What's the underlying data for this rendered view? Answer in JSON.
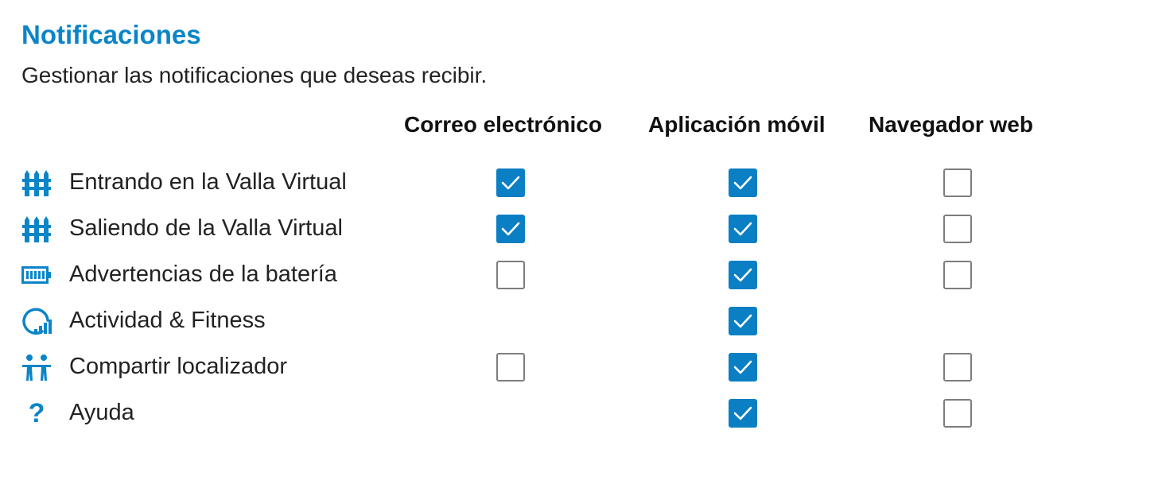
{
  "header": {
    "title": "Notificaciones",
    "subtitle": "Gestionar las notificaciones que deseas recibir."
  },
  "columns": [
    {
      "label": "Correo electrónico"
    },
    {
      "label": "Aplicación móvil"
    },
    {
      "label": "Navegador web"
    }
  ],
  "colors": {
    "accent": "#0a85c8",
    "checkbox_checked": "#0a7fc4",
    "checkbox_border": "#7d7d7d"
  },
  "rows": [
    {
      "label": "Entrando en la Valla Virtual",
      "icon": "fence-icon",
      "email": true,
      "app": true,
      "web": false
    },
    {
      "label": "Saliendo de la Valla Virtual",
      "icon": "fence-icon",
      "email": true,
      "app": true,
      "web": false
    },
    {
      "label": "Advertencias de la batería",
      "icon": "battery-icon",
      "email": false,
      "app": true,
      "web": false
    },
    {
      "label": "Actividad & Fitness",
      "icon": "activity-gauge-icon",
      "email": null,
      "app": true,
      "web": null
    },
    {
      "label": "Compartir localizador",
      "icon": "people-share-icon",
      "email": false,
      "app": true,
      "web": false
    },
    {
      "label": "Ayuda",
      "icon": "question-icon",
      "email": null,
      "app": true,
      "web": false
    }
  ]
}
